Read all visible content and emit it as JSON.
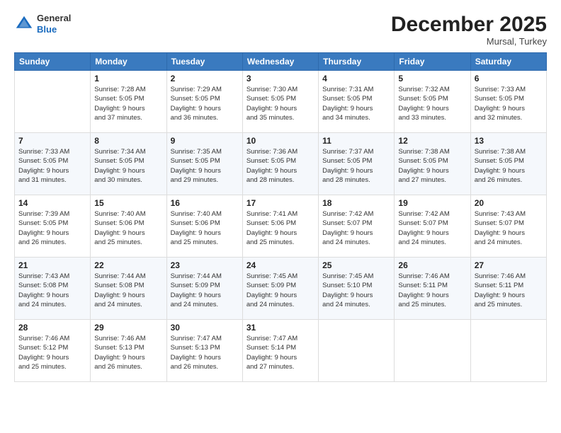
{
  "logo": {
    "general": "General",
    "blue": "Blue"
  },
  "header": {
    "month": "December 2025",
    "location": "Mursal, Turkey"
  },
  "weekdays": [
    "Sunday",
    "Monday",
    "Tuesday",
    "Wednesday",
    "Thursday",
    "Friday",
    "Saturday"
  ],
  "weeks": [
    [
      {
        "day": "",
        "info": ""
      },
      {
        "day": "1",
        "info": "Sunrise: 7:28 AM\nSunset: 5:05 PM\nDaylight: 9 hours\nand 37 minutes."
      },
      {
        "day": "2",
        "info": "Sunrise: 7:29 AM\nSunset: 5:05 PM\nDaylight: 9 hours\nand 36 minutes."
      },
      {
        "day": "3",
        "info": "Sunrise: 7:30 AM\nSunset: 5:05 PM\nDaylight: 9 hours\nand 35 minutes."
      },
      {
        "day": "4",
        "info": "Sunrise: 7:31 AM\nSunset: 5:05 PM\nDaylight: 9 hours\nand 34 minutes."
      },
      {
        "day": "5",
        "info": "Sunrise: 7:32 AM\nSunset: 5:05 PM\nDaylight: 9 hours\nand 33 minutes."
      },
      {
        "day": "6",
        "info": "Sunrise: 7:33 AM\nSunset: 5:05 PM\nDaylight: 9 hours\nand 32 minutes."
      }
    ],
    [
      {
        "day": "7",
        "info": "Sunrise: 7:33 AM\nSunset: 5:05 PM\nDaylight: 9 hours\nand 31 minutes."
      },
      {
        "day": "8",
        "info": "Sunrise: 7:34 AM\nSunset: 5:05 PM\nDaylight: 9 hours\nand 30 minutes."
      },
      {
        "day": "9",
        "info": "Sunrise: 7:35 AM\nSunset: 5:05 PM\nDaylight: 9 hours\nand 29 minutes."
      },
      {
        "day": "10",
        "info": "Sunrise: 7:36 AM\nSunset: 5:05 PM\nDaylight: 9 hours\nand 28 minutes."
      },
      {
        "day": "11",
        "info": "Sunrise: 7:37 AM\nSunset: 5:05 PM\nDaylight: 9 hours\nand 28 minutes."
      },
      {
        "day": "12",
        "info": "Sunrise: 7:38 AM\nSunset: 5:05 PM\nDaylight: 9 hours\nand 27 minutes."
      },
      {
        "day": "13",
        "info": "Sunrise: 7:38 AM\nSunset: 5:05 PM\nDaylight: 9 hours\nand 26 minutes."
      }
    ],
    [
      {
        "day": "14",
        "info": "Sunrise: 7:39 AM\nSunset: 5:05 PM\nDaylight: 9 hours\nand 26 minutes."
      },
      {
        "day": "15",
        "info": "Sunrise: 7:40 AM\nSunset: 5:06 PM\nDaylight: 9 hours\nand 25 minutes."
      },
      {
        "day": "16",
        "info": "Sunrise: 7:40 AM\nSunset: 5:06 PM\nDaylight: 9 hours\nand 25 minutes."
      },
      {
        "day": "17",
        "info": "Sunrise: 7:41 AM\nSunset: 5:06 PM\nDaylight: 9 hours\nand 25 minutes."
      },
      {
        "day": "18",
        "info": "Sunrise: 7:42 AM\nSunset: 5:07 PM\nDaylight: 9 hours\nand 24 minutes."
      },
      {
        "day": "19",
        "info": "Sunrise: 7:42 AM\nSunset: 5:07 PM\nDaylight: 9 hours\nand 24 minutes."
      },
      {
        "day": "20",
        "info": "Sunrise: 7:43 AM\nSunset: 5:07 PM\nDaylight: 9 hours\nand 24 minutes."
      }
    ],
    [
      {
        "day": "21",
        "info": "Sunrise: 7:43 AM\nSunset: 5:08 PM\nDaylight: 9 hours\nand 24 minutes."
      },
      {
        "day": "22",
        "info": "Sunrise: 7:44 AM\nSunset: 5:08 PM\nDaylight: 9 hours\nand 24 minutes."
      },
      {
        "day": "23",
        "info": "Sunrise: 7:44 AM\nSunset: 5:09 PM\nDaylight: 9 hours\nand 24 minutes."
      },
      {
        "day": "24",
        "info": "Sunrise: 7:45 AM\nSunset: 5:09 PM\nDaylight: 9 hours\nand 24 minutes."
      },
      {
        "day": "25",
        "info": "Sunrise: 7:45 AM\nSunset: 5:10 PM\nDaylight: 9 hours\nand 24 minutes."
      },
      {
        "day": "26",
        "info": "Sunrise: 7:46 AM\nSunset: 5:11 PM\nDaylight: 9 hours\nand 25 minutes."
      },
      {
        "day": "27",
        "info": "Sunrise: 7:46 AM\nSunset: 5:11 PM\nDaylight: 9 hours\nand 25 minutes."
      }
    ],
    [
      {
        "day": "28",
        "info": "Sunrise: 7:46 AM\nSunset: 5:12 PM\nDaylight: 9 hours\nand 25 minutes."
      },
      {
        "day": "29",
        "info": "Sunrise: 7:46 AM\nSunset: 5:13 PM\nDaylight: 9 hours\nand 26 minutes."
      },
      {
        "day": "30",
        "info": "Sunrise: 7:47 AM\nSunset: 5:13 PM\nDaylight: 9 hours\nand 26 minutes."
      },
      {
        "day": "31",
        "info": "Sunrise: 7:47 AM\nSunset: 5:14 PM\nDaylight: 9 hours\nand 27 minutes."
      },
      {
        "day": "",
        "info": ""
      },
      {
        "day": "",
        "info": ""
      },
      {
        "day": "",
        "info": ""
      }
    ]
  ]
}
